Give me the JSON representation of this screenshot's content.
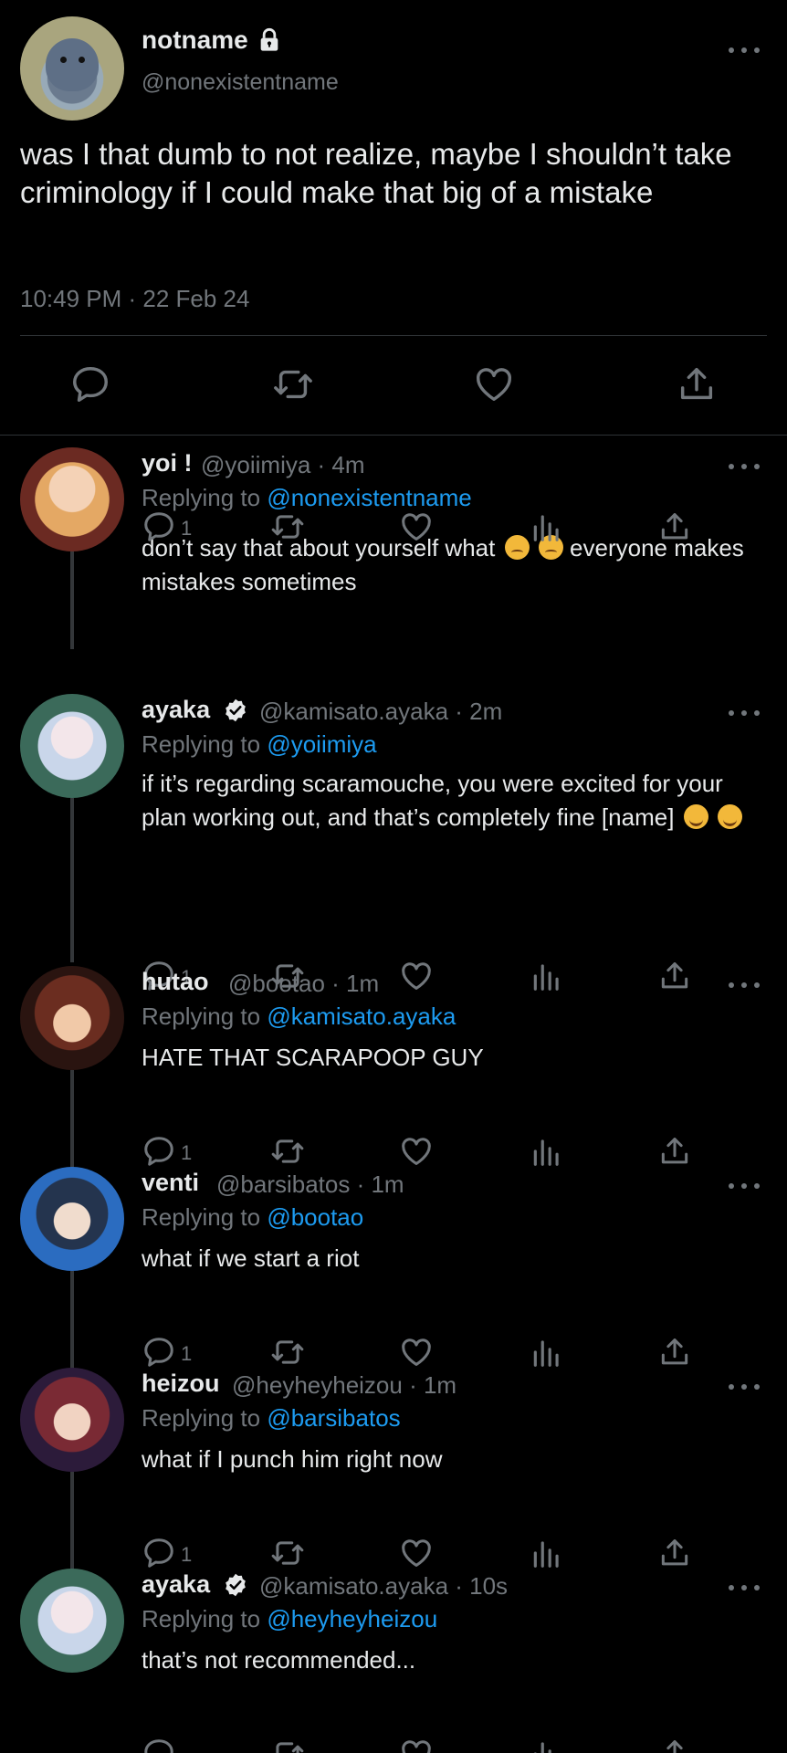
{
  "main_tweet": {
    "name": "notname",
    "handle": "@nonexistentname",
    "text": "was I that dumb to not realize, maybe I shouldn’t take criminology if I could make that big of a mistake",
    "timestamp": "10:49 PM · 22 Feb 24",
    "icons": [
      "lock-icon",
      "more-icon",
      "reply-icon",
      "retweet-icon",
      "like-icon",
      "share-icon"
    ]
  },
  "replies": [
    {
      "name": "yoi !",
      "handle": "@yoiimiya · 4m",
      "verified": false,
      "replying_prefix": "Replying to",
      "replying_to": "@nonexistentname",
      "text": "don’t say that about yourself what",
      "emoji_suffix": [
        "worried",
        "worried"
      ],
      "text_after_emoji": " everyone makes mistakes sometimes",
      "reply_count": "1"
    },
    {
      "name": "ayaka",
      "handle": "@kamisato.ayaka · 2m",
      "verified": true,
      "replying_prefix": "Replying to",
      "replying_to": "@yoiimiya",
      "text": "if it’s regarding scaramouche, you were excited for your plan working out, and that’s completely fine [name]",
      "emoji_suffix": [
        "hugging",
        "hugging"
      ],
      "text_after_emoji": "",
      "reply_count": "1"
    },
    {
      "name": "hutao",
      "handle": "@bootao · 1m",
      "verified": false,
      "replying_prefix": "Replying to",
      "replying_to": "@kamisato.ayaka",
      "text": "HATE THAT SCARAPOOP GUY",
      "emoji_suffix": [],
      "text_after_emoji": "",
      "reply_count": "1"
    },
    {
      "name": "venti",
      "handle": "@barsibatos · 1m",
      "verified": false,
      "replying_prefix": "Replying to",
      "replying_to": "@bootao",
      "text": "what if we start a riot",
      "emoji_suffix": [],
      "text_after_emoji": "",
      "reply_count": "1"
    },
    {
      "name": "heizou",
      "handle": "@heyheyheizou · 1m",
      "verified": false,
      "replying_prefix": "Replying to",
      "replying_to": "@barsibatos",
      "text": "what if I punch him right now",
      "emoji_suffix": [],
      "text_after_emoji": "",
      "reply_count": "1"
    },
    {
      "name": "ayaka",
      "handle": "@kamisato.ayaka · 10s",
      "verified": true,
      "replying_prefix": "Replying to",
      "replying_to": "@heyheyheizou",
      "text": "that’s not recommended...",
      "emoji_suffix": [],
      "text_after_emoji": "",
      "reply_count": ""
    }
  ],
  "colors": {
    "background": "#000000",
    "text": "#e7e9ea",
    "muted": "#71767b",
    "link": "#1d9bf0",
    "divider": "#2f3336"
  }
}
